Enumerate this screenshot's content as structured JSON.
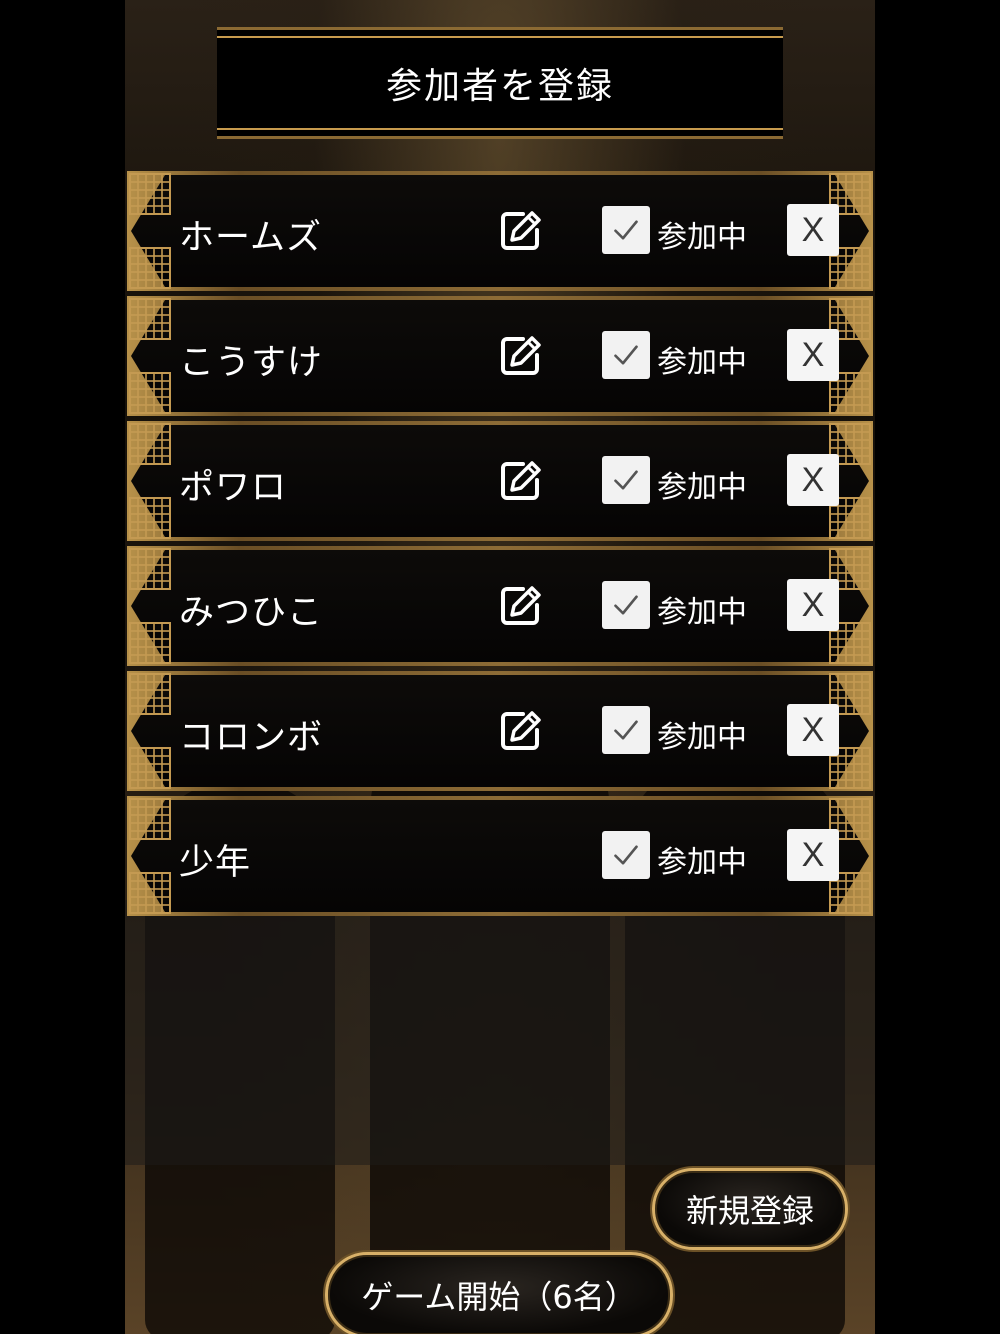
{
  "header": {
    "title": "参加者を登録"
  },
  "participants": [
    {
      "name": "ホームズ",
      "editable": true,
      "checked": true,
      "status": "参加中",
      "remove_label": "X"
    },
    {
      "name": "こうすけ",
      "editable": true,
      "checked": true,
      "status": "参加中",
      "remove_label": "X"
    },
    {
      "name": "ポワロ",
      "editable": true,
      "checked": true,
      "status": "参加中",
      "remove_label": "X"
    },
    {
      "name": "みつひこ",
      "editable": true,
      "checked": true,
      "status": "参加中",
      "remove_label": "X"
    },
    {
      "name": "コロンボ",
      "editable": true,
      "checked": true,
      "status": "参加中",
      "remove_label": "X"
    },
    {
      "name": "少年",
      "editable": false,
      "checked": true,
      "status": "参加中",
      "remove_label": "X"
    }
  ],
  "buttons": {
    "new_register": "新規登録",
    "start_game": "ゲーム開始（6名）"
  },
  "icons": {
    "edit": "edit-icon",
    "check": "checkmark-icon",
    "remove": "close-icon"
  },
  "colors": {
    "gold": "#c79b4e",
    "panel": "#050404",
    "checkbox": "#f2f2f2"
  }
}
